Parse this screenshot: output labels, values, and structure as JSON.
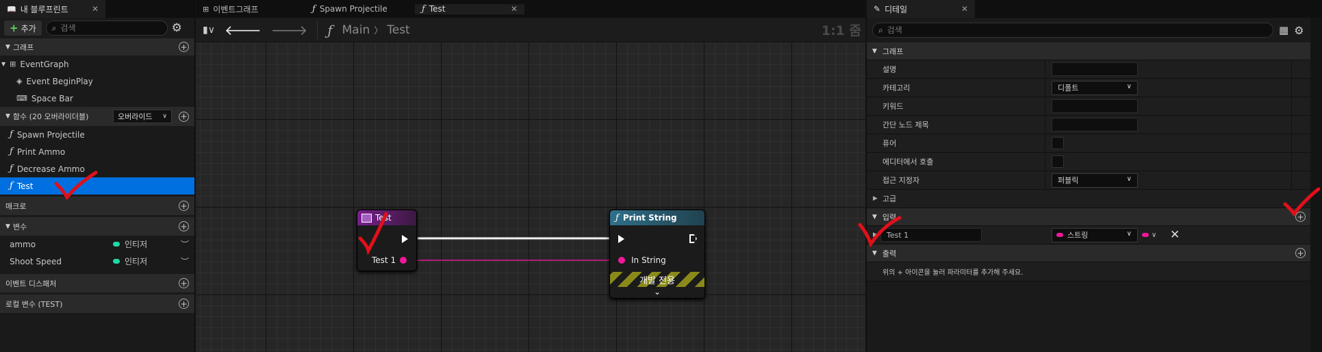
{
  "left_panel": {
    "tab_title": "내 블루프린트",
    "add_label": "추가",
    "search_placeholder": "검색",
    "graphs_section": "그래프",
    "graph_items": [
      "EventGraph",
      "Event BeginPlay",
      "Space Bar"
    ],
    "functions_section": "함수 (20 오버라이더블)",
    "override_label": "오버라이드",
    "functions": [
      "Spawn Projectile",
      "Print Ammo",
      "Decrease Ammo",
      "Test"
    ],
    "macros_section": "매크로",
    "variables_section": "변수",
    "variables": [
      {
        "name": "ammo",
        "type": "인티저"
      },
      {
        "name": "Shoot Speed",
        "type": "인티저"
      }
    ],
    "dispatchers_section": "이벤트 디스패처",
    "local_vars_section": "로컬 변수 (TEST)"
  },
  "graph_tabs": [
    "이벤트그래프",
    "Spawn Projectile",
    "Test"
  ],
  "graph_toolbar": {
    "breadcrumb_root": "Main",
    "breadcrumb_sep": "〉",
    "breadcrumb_current": "Test",
    "zoom": "1:1 줌"
  },
  "nodes": {
    "entry_title": "Test",
    "entry_pin": "Test 1",
    "print_title": "Print String",
    "print_pin": "In String",
    "dev_only": "개발 전용"
  },
  "details": {
    "tab_title": "디테일",
    "search_placeholder": "검색",
    "graph_section": "그래프",
    "description_label": "설명",
    "category_label": "카테고리",
    "category_value": "디폴트",
    "keywords_label": "키워드",
    "compact_title_label": "간단 노드 제목",
    "pure_label": "퓨어",
    "call_in_editor_label": "에디터에서 호출",
    "access_label": "접근 지정자",
    "access_value": "퍼블릭",
    "advanced_label": "고급",
    "inputs_section": "입력",
    "input_name": "Test 1",
    "input_type": "스트링",
    "outputs_section": "출력",
    "outputs_hint": "위의 + 아이콘을 눌러 파라미터를 추가해 주세요."
  },
  "colors": {
    "accent": "#0070e0",
    "string_pin": "#f0189a",
    "integer_pin": "#1fd8a8",
    "check_mark": "#e0101a"
  }
}
